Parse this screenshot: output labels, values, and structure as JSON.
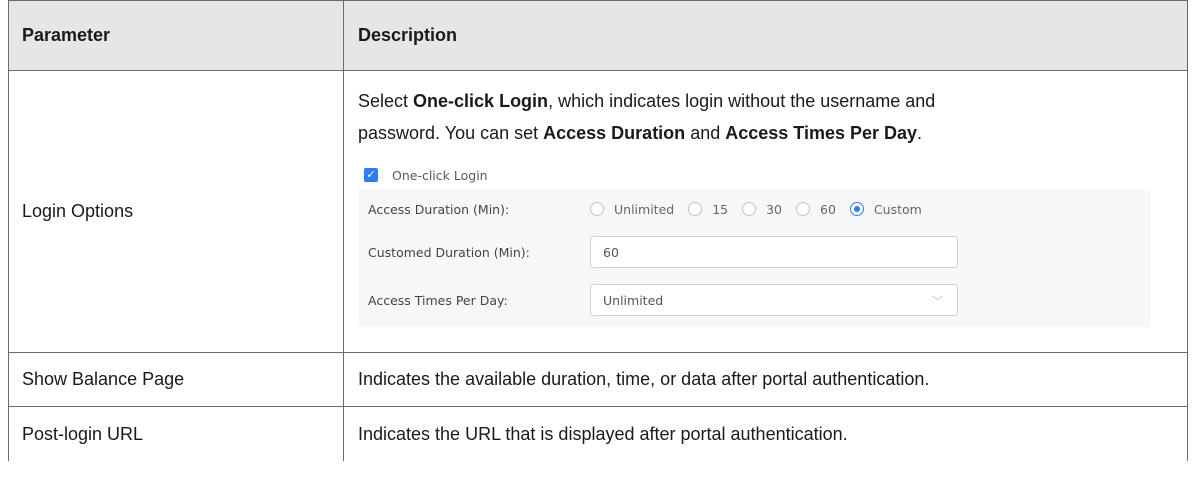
{
  "header": {
    "col1": "Parameter",
    "col2": "Description"
  },
  "rows": [
    {
      "param": "Login Options",
      "desc": {
        "p1_pre": "Select ",
        "p1_b1": "One-click Login",
        "p1_mid": ", which indicates login without the username and",
        "p2_pre": "password. You can set ",
        "p2_b1": "Access Duration",
        "p2_mid": " and ",
        "p2_b2": "Access Times Per Day",
        "p2_end": "."
      },
      "ui": {
        "checkbox_label": "One-click Login",
        "checkbox_checked": true,
        "duration_label": "Access Duration (Min):",
        "duration_options": [
          "Unlimited",
          "15",
          "30",
          "60",
          "Custom"
        ],
        "duration_selected": "Custom",
        "custom_label": "Customed Duration (Min):",
        "custom_value": "60",
        "times_label": "Access Times Per Day:",
        "times_value": "Unlimited"
      }
    },
    {
      "param": "Show Balance Page",
      "desc_text": "Indicates the available duration, time, or data after portal authentication."
    },
    {
      "param": "Post-login URL",
      "desc_text": "Indicates the URL that is displayed after portal authentication."
    }
  ],
  "colors": {
    "accent": "#2f7df6",
    "header_bg": "#e6e6e6",
    "panel_bg": "#f6f7f9"
  }
}
